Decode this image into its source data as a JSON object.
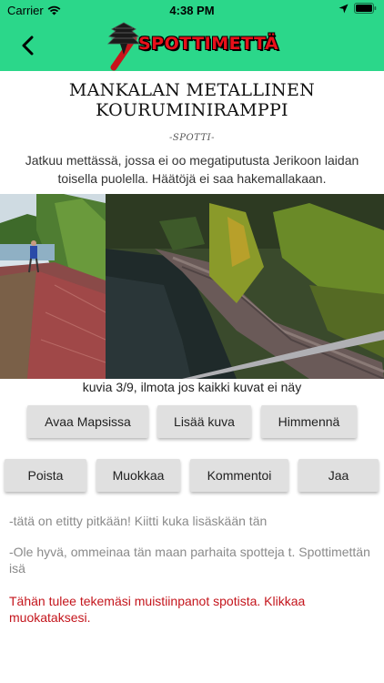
{
  "status": {
    "carrier": "Carrier",
    "time": "4:38 PM"
  },
  "nav": {
    "logo_text": "SPOTTIMETTÄ"
  },
  "spot": {
    "title": "MANKALAN METALLINEN KOURUMINIRAMPPI",
    "type_label": "-SPOTTI-",
    "description": "Jatkuu mettässä, jossa ei oo megatiputusta Jerikoon laidan toisella puolella. Häätöjä ei saa hakemallakaan."
  },
  "photo": {
    "caption": "kuvia 3/9, ilmota jos kaikki kuvat ei näy"
  },
  "buttons": {
    "open_maps": "Avaa Mapsissa",
    "add_photo": "Lisää kuva",
    "dim": "Himmennä",
    "delete": "Poista",
    "edit": "Muokkaa",
    "comment": "Kommentoi",
    "share": "Jaa"
  },
  "comments": [
    "-tätä on etitty pitkään! Kiitti kuka lisäskään tän",
    "-Ole hyvä, ommeinaa tän maan parhaita spotteja t. Spottimettän isä"
  ],
  "notes_placeholder": "Tähän tulee tekemäsi muistiinpanot spotista. Klikkaa muokataksesi.",
  "colors": {
    "header_bg": "#2bd78a",
    "logo_text": "#e8101a",
    "note_text": "#c4151c",
    "button_bg": "#e0e0e0"
  }
}
